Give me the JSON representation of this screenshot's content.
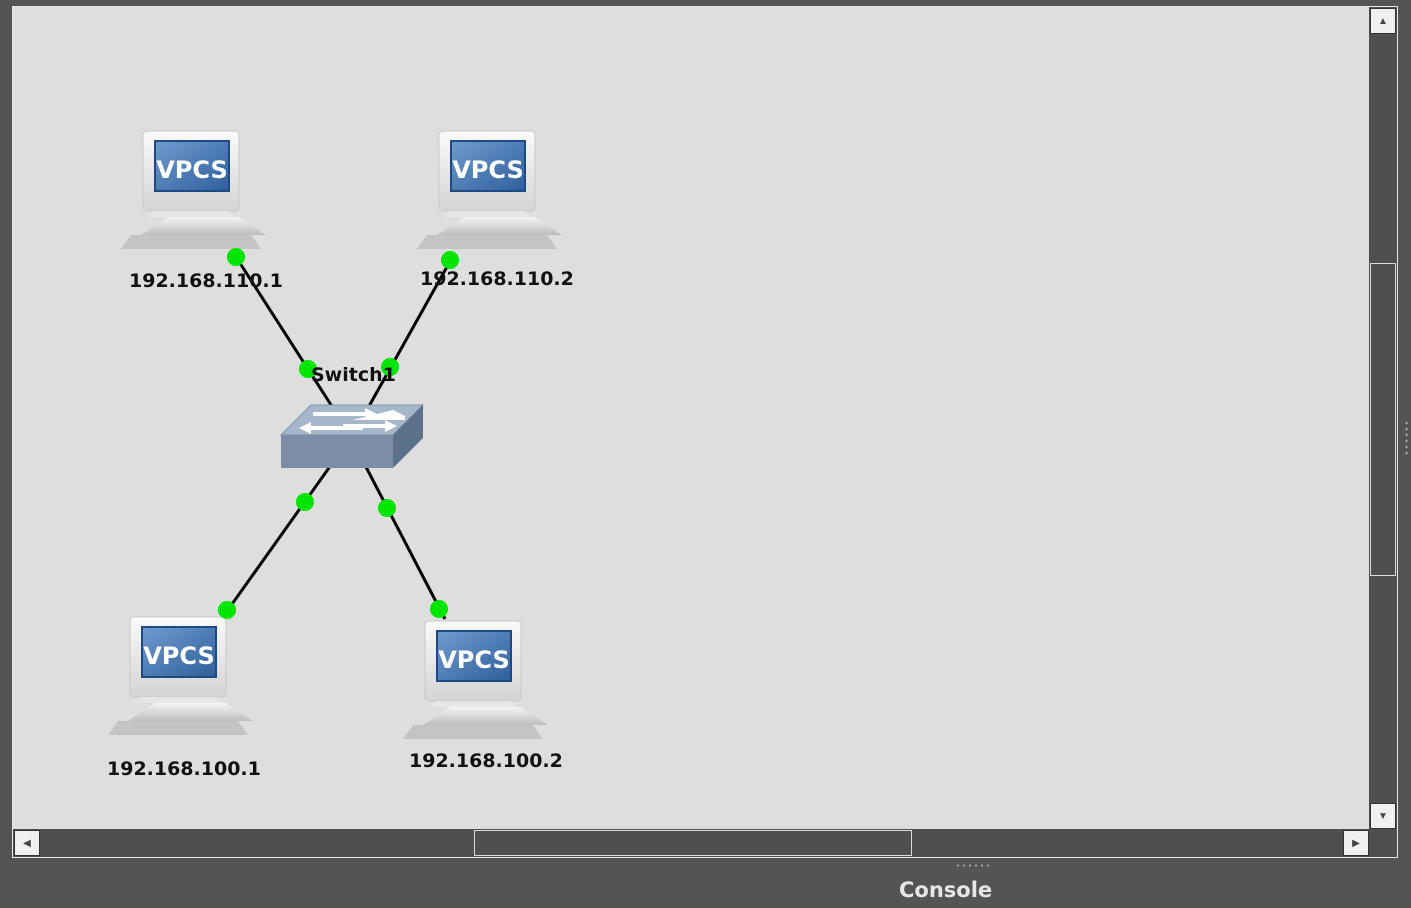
{
  "nodes": {
    "pc1": {
      "label": "192.168.110.1",
      "icon_text": "VPCS"
    },
    "pc2": {
      "label": "192.168.110.2",
      "icon_text": "VPCS"
    },
    "pc3": {
      "label": "192.168.100.1",
      "icon_text": "VPCS"
    },
    "pc4": {
      "label": "192.168.100.2",
      "icon_text": "VPCS"
    },
    "switch": {
      "label": "Switch1"
    }
  },
  "link_status_color": "#00e600",
  "canvas_background": "#dedede",
  "console": {
    "label": "Console"
  },
  "icons": {
    "scroll_up": "triangle-up-icon",
    "scroll_down": "triangle-down-icon",
    "scroll_left": "triangle-left-icon",
    "scroll_right": "triangle-right-icon"
  }
}
